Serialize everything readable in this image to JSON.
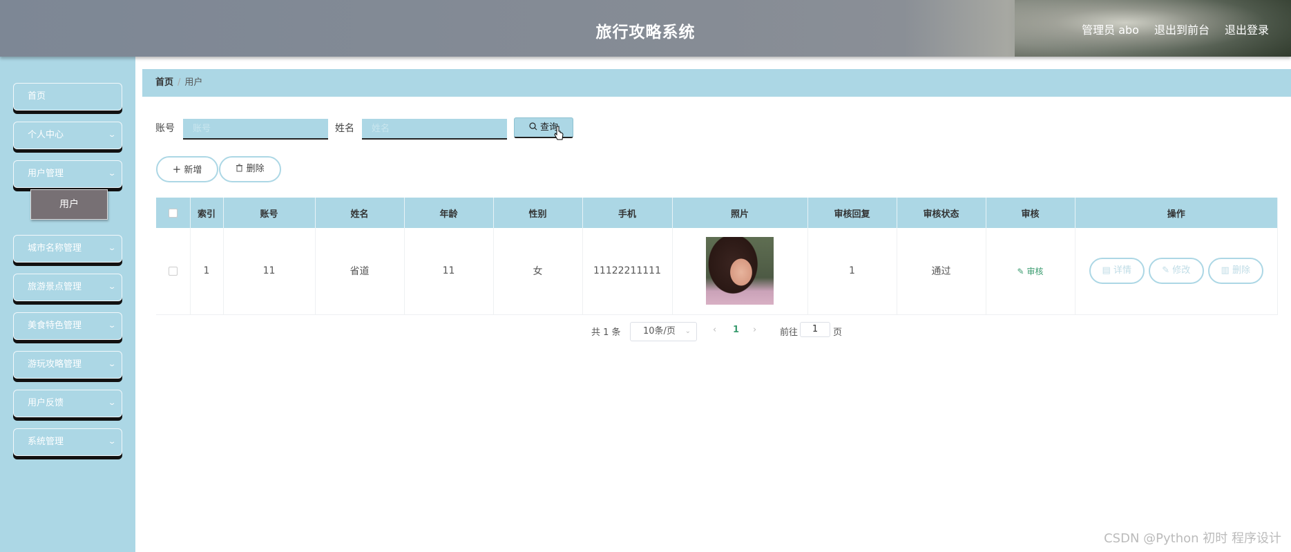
{
  "header": {
    "title": "旅行攻略系统",
    "admin": "管理员 abo",
    "to_front": "退出到前台",
    "logout": "退出登录"
  },
  "sidebar": {
    "items": [
      {
        "label": "首页",
        "has_arrow": false
      },
      {
        "label": "个人中心",
        "has_arrow": true
      },
      {
        "label": "用户管理",
        "has_arrow": true
      },
      {
        "label": "城市名称管理",
        "has_arrow": true
      },
      {
        "label": "旅游景点管理",
        "has_arrow": true
      },
      {
        "label": "美食特色管理",
        "has_arrow": true
      },
      {
        "label": "游玩攻略管理",
        "has_arrow": true
      },
      {
        "label": "用户反馈",
        "has_arrow": true
      },
      {
        "label": "系统管理",
        "has_arrow": true
      }
    ],
    "sub_item": "用户",
    "chevron": "⌄"
  },
  "breadcrumb": {
    "home": "首页",
    "separator": "/",
    "current": "用户"
  },
  "search": {
    "account_label": "账号",
    "account_placeholder": "账号",
    "name_label": "姓名",
    "name_placeholder": "姓名",
    "query_button": "查询",
    "query_icon": "search-icon"
  },
  "actions": {
    "add": "新增",
    "delete": "删除"
  },
  "table": {
    "columns": [
      "索引",
      "账号",
      "姓名",
      "年龄",
      "性别",
      "手机",
      "照片",
      "审核回复",
      "审核状态",
      "审核",
      "操作"
    ],
    "rows": [
      {
        "index": "1",
        "account": "11",
        "name": "省道",
        "age": "11",
        "gender": "女",
        "phone": "11122211111",
        "audit_reply": "1",
        "audit_status": "通过",
        "audit_link": "审核",
        "detail": "详情",
        "edit": "修改",
        "remove": "删除"
      }
    ]
  },
  "pagination": {
    "total": "共 1 条",
    "page_size": "10条/页",
    "current_page": "1",
    "goto_label": "前往",
    "goto_value": "1",
    "page_suffix": "页"
  },
  "colors": {
    "accent": "#acd7e5",
    "selected_sub": "#777074",
    "audit_link": "#3a9b6f"
  },
  "watermark": "CSDN @Python 初时 程序设计"
}
